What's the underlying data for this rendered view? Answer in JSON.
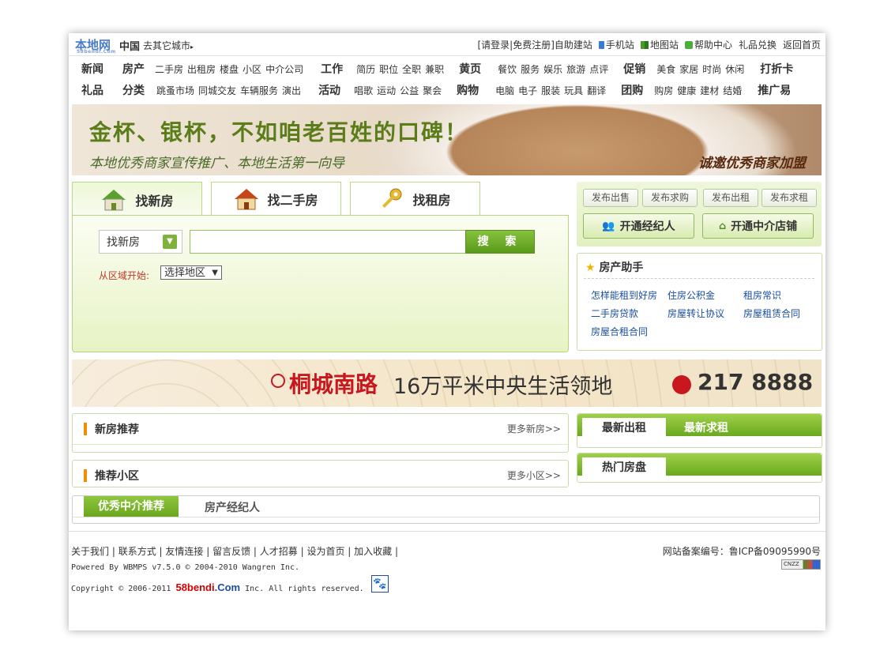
{
  "topbar": {
    "logo": "本地网",
    "logo_sub": "58bendi.Com",
    "city": "中国",
    "other_city": "去其它城市",
    "links": [
      "[请登录",
      "|免费注册]",
      "自助建站",
      "手机站",
      "地图站",
      "帮助中心",
      "礼品兑换",
      "返回首页"
    ]
  },
  "nav": {
    "row1": {
      "groups": [
        {
          "head": "新闻",
          "items": []
        },
        {
          "head": "房产",
          "items": [
            "二手房",
            "出租房",
            "楼盘",
            "小区",
            "中介公司"
          ]
        },
        {
          "head": "工作",
          "items": [
            "简历",
            "职位",
            "全职",
            "兼职"
          ]
        },
        {
          "head": "黄页",
          "items": [
            "餐饮",
            "服务",
            "娱乐",
            "旅游",
            "点评"
          ]
        },
        {
          "head": "促销",
          "items": [
            "美食",
            "家居",
            "时尚",
            "休闲"
          ]
        },
        {
          "head": "打折卡",
          "items": []
        }
      ]
    },
    "row2": {
      "groups": [
        {
          "head": "礼品",
          "items": []
        },
        {
          "head": "分类",
          "items": [
            "跳蚤市场",
            "同城交友",
            "车辆服务",
            "演出"
          ]
        },
        {
          "head": "活动",
          "items": [
            "唱歌",
            "运动",
            "公益",
            "聚会"
          ]
        },
        {
          "head": "购物",
          "items": [
            "电脑",
            "电子",
            "服装",
            "玩具",
            "翻译"
          ]
        },
        {
          "head": "团购",
          "items": [
            "购房",
            "健康",
            "建材",
            "结婚"
          ]
        },
        {
          "head": "推广易",
          "items": []
        }
      ]
    },
    "red_items": [
      "出租房",
      "职位",
      "点评",
      "聚会",
      "结婚"
    ]
  },
  "banner": {
    "headline": "金杯、银杯，不如咱老百姓的口碑！",
    "subline": "本地优秀商家宣传推广、本地生活第一向导",
    "cta": "诚邀优秀商家加盟"
  },
  "search": {
    "tabs": [
      "找新房",
      "找二手房",
      "找租房"
    ],
    "active_tab": 0,
    "type_value": "找新房",
    "input_value": "",
    "button": "搜 索",
    "area_label": "从区域开始:",
    "area_value": "选择地区"
  },
  "publish": {
    "buttons": [
      "发布出售",
      "发布求购",
      "发布出租",
      "发布求租"
    ],
    "big_buttons": [
      "开通经纪人",
      "开通中介店铺"
    ]
  },
  "helper": {
    "title": "房产助手",
    "links": [
      "怎样能租到好房",
      "住房公积金",
      "租房常识",
      "二手房贷款",
      "房屋转让协议",
      "房屋租赁合同",
      "房屋合租合同"
    ]
  },
  "ad": {
    "road": "桐城南路",
    "slogan": "16万平米中央生活领地",
    "phone": "217 8888"
  },
  "sections": {
    "new_houses": {
      "title": "新房推荐",
      "more": "更多新房>>"
    },
    "communities": {
      "title": "推荐小区",
      "more": "更多小区>>"
    },
    "rent_tabs": {
      "active": "最新出租",
      "other": "最新求租"
    },
    "hot": {
      "title": "热门房盘"
    },
    "agent_tabs": {
      "active": "优秀中介推荐",
      "other": "房产经纪人"
    }
  },
  "footer": {
    "links": [
      "关于我们",
      "联系方式",
      "友情连接",
      "留言反馈",
      "人才招募",
      "设为首页",
      "加入收藏"
    ],
    "icp": "网站备案编号：鲁ICP备09095990号",
    "powered": "Powered By WBMPS v7.5.0 © 2004-2010 Wangren Inc.",
    "copyright_prefix": "Copyright © 2006-2011",
    "brand": "58bendi",
    "brand_suffix": ".Com",
    "copyright_suffix": "Inc. All rights reserved.",
    "cnzz": "CNZZ"
  },
  "colors": {
    "green": "#6aa91f",
    "red": "#d40000",
    "orange": "#f28c00",
    "link_blue": "#1a4fa0"
  }
}
